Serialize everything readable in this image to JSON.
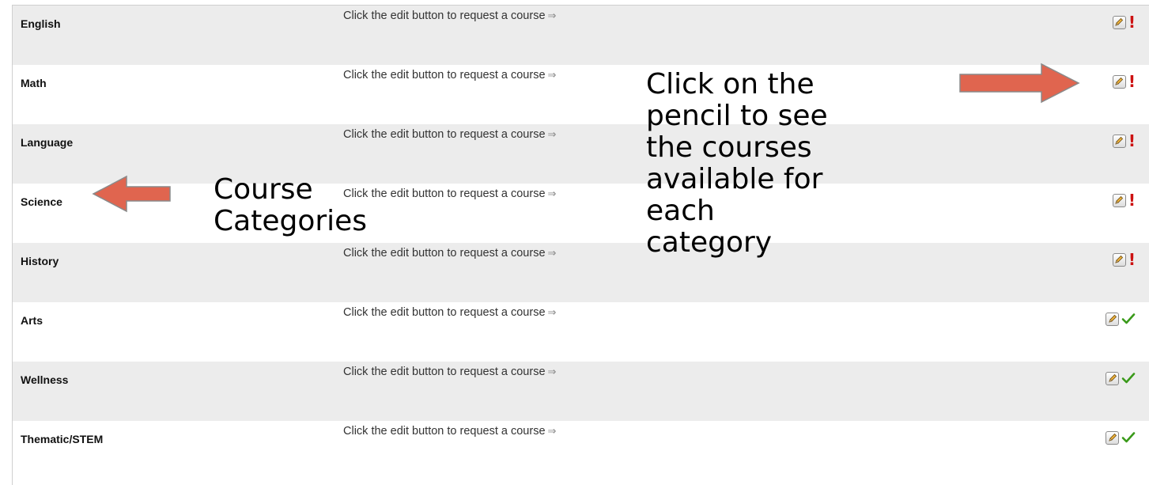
{
  "table": {
    "hint_text": "Click the edit button to request a course",
    "rows": [
      {
        "category": "English",
        "hint": "Click the edit button to request a course",
        "status": "incomplete"
      },
      {
        "category": "Math",
        "hint": "Click the edit button to request a course",
        "status": "incomplete"
      },
      {
        "category": "Language",
        "hint": "Click the edit button to request a course",
        "status": "incomplete"
      },
      {
        "category": "Science",
        "hint": "Click the edit button to request a course",
        "status": "incomplete"
      },
      {
        "category": "History",
        "hint": "Click the edit button to request a course",
        "status": "incomplete"
      },
      {
        "category": "Arts",
        "hint": "Click the edit button to request a course",
        "status": "complete"
      },
      {
        "category": "Wellness",
        "hint": "Click the edit button to request a course",
        "status": "complete"
      },
      {
        "category": "Thematic/STEM",
        "hint": "Click the edit button to request a course",
        "status": "complete"
      }
    ]
  },
  "annotations": {
    "categories_label": "Course\nCategories",
    "pencil_label": "Click on the\npencil to see\nthe courses\navailable for\neach\ncategory"
  },
  "icons": {
    "edit": "pencil-icon",
    "incomplete": "exclamation-icon",
    "complete": "checkmark-icon",
    "hint_arrow": "right-arrow-icon"
  },
  "colors": {
    "callout_arrow": "#e0654f",
    "incomplete": "#cc1111",
    "complete": "#3a9a1a",
    "odd_row": "#ececec"
  }
}
